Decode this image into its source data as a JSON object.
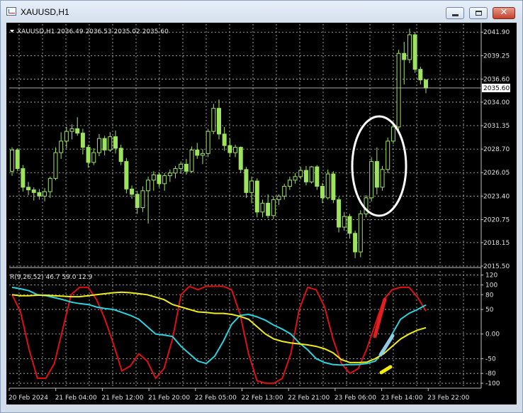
{
  "window": {
    "title": "XAUUSD,H1",
    "close_glyph": "✕"
  },
  "chart_data": [
    {
      "type": "candlestick",
      "symbol": "XAUUSD,H1",
      "header": "XAUUSD,H1  2036.49 2036.53 2035.02 2035.60",
      "current_price": "2035.60",
      "ylim": [
        2015.5,
        2042.8
      ],
      "y_ticks": [
        "2041.90",
        "2039.25",
        "2036.60",
        "2034.00",
        "2031.35",
        "2028.70",
        "2026.05",
        "2023.40",
        "2020.75",
        "2018.15",
        "2015.50"
      ],
      "x_ticks": [
        "20 Feb 2024",
        "21 Feb 04:00",
        "21 Feb 12:00",
        "21 Feb 20:00",
        "22 Feb 05:00",
        "22 Feb 13:00",
        "22 Feb 21:00",
        "23 Feb 06:00",
        "23 Feb 14:00",
        "23 Feb 22:00"
      ],
      "grid": true,
      "colors": {
        "background": "#000000",
        "bull": "#9de35d",
        "bear": "#9de35d",
        "grid": "#c0c0c0",
        "axis": "#c0c0c0"
      },
      "candles": [
        {
          "o": 2026.2,
          "h": 2028.9,
          "l": 2025.7,
          "c": 2028.6
        },
        {
          "o": 2028.6,
          "h": 2028.8,
          "l": 2026.2,
          "c": 2026.5
        },
        {
          "o": 2026.5,
          "h": 2026.9,
          "l": 2023.9,
          "c": 2024.4
        },
        {
          "o": 2024.4,
          "h": 2025.0,
          "l": 2023.5,
          "c": 2024.1
        },
        {
          "o": 2024.1,
          "h": 2024.4,
          "l": 2022.9,
          "c": 2023.8
        },
        {
          "o": 2023.8,
          "h": 2024.2,
          "l": 2023.0,
          "c": 2023.4
        },
        {
          "o": 2023.4,
          "h": 2024.3,
          "l": 2022.8,
          "c": 2023.9
        },
        {
          "o": 2023.9,
          "h": 2025.6,
          "l": 2023.2,
          "c": 2025.4
        },
        {
          "o": 2025.4,
          "h": 2028.9,
          "l": 2025.2,
          "c": 2028.3
        },
        {
          "o": 2028.3,
          "h": 2030.6,
          "l": 2027.6,
          "c": 2029.6
        },
        {
          "o": 2029.6,
          "h": 2031.2,
          "l": 2028.8,
          "c": 2030.7
        },
        {
          "o": 2030.7,
          "h": 2031.5,
          "l": 2029.8,
          "c": 2031.0
        },
        {
          "o": 2031.0,
          "h": 2032.3,
          "l": 2030.2,
          "c": 2030.5
        },
        {
          "o": 2030.5,
          "h": 2031.0,
          "l": 2028.1,
          "c": 2028.9
        },
        {
          "o": 2028.9,
          "h": 2029.2,
          "l": 2026.6,
          "c": 2027.2
        },
        {
          "o": 2027.2,
          "h": 2028.8,
          "l": 2026.9,
          "c": 2028.3
        },
        {
          "o": 2028.3,
          "h": 2030.4,
          "l": 2027.9,
          "c": 2029.9
        },
        {
          "o": 2029.9,
          "h": 2030.2,
          "l": 2028.0,
          "c": 2028.6
        },
        {
          "o": 2028.6,
          "h": 2030.6,
          "l": 2028.4,
          "c": 2030.1
        },
        {
          "o": 2030.1,
          "h": 2030.8,
          "l": 2028.2,
          "c": 2028.8
        },
        {
          "o": 2028.8,
          "h": 2029.2,
          "l": 2026.9,
          "c": 2027.3
        },
        {
          "o": 2027.3,
          "h": 2027.7,
          "l": 2023.7,
          "c": 2024.2
        },
        {
          "o": 2024.2,
          "h": 2024.6,
          "l": 2023.1,
          "c": 2023.6
        },
        {
          "o": 2023.6,
          "h": 2024.0,
          "l": 2021.4,
          "c": 2022.1
        },
        {
          "o": 2022.1,
          "h": 2024.5,
          "l": 2021.6,
          "c": 2024.0
        },
        {
          "o": 2024.0,
          "h": 2025.6,
          "l": 2020.3,
          "c": 2025.2
        },
        {
          "o": 2025.2,
          "h": 2026.2,
          "l": 2024.0,
          "c": 2025.8
        },
        {
          "o": 2025.8,
          "h": 2026.1,
          "l": 2024.4,
          "c": 2024.8
        },
        {
          "o": 2024.8,
          "h": 2026.0,
          "l": 2024.0,
          "c": 2025.7
        },
        {
          "o": 2025.7,
          "h": 2026.4,
          "l": 2025.0,
          "c": 2026.0
        },
        {
          "o": 2026.0,
          "h": 2026.8,
          "l": 2025.4,
          "c": 2026.5
        },
        {
          "o": 2026.5,
          "h": 2027.3,
          "l": 2025.9,
          "c": 2027.0
        },
        {
          "o": 2027.0,
          "h": 2027.6,
          "l": 2025.8,
          "c": 2026.2
        },
        {
          "o": 2026.2,
          "h": 2029.0,
          "l": 2026.0,
          "c": 2028.6
        },
        {
          "o": 2028.6,
          "h": 2029.4,
          "l": 2027.6,
          "c": 2028.0
        },
        {
          "o": 2028.0,
          "h": 2028.7,
          "l": 2027.0,
          "c": 2028.2
        },
        {
          "o": 2028.2,
          "h": 2031.0,
          "l": 2027.8,
          "c": 2030.7
        },
        {
          "o": 2030.7,
          "h": 2033.8,
          "l": 2030.4,
          "c": 2033.3
        },
        {
          "o": 2033.3,
          "h": 2034.3,
          "l": 2029.8,
          "c": 2030.4
        },
        {
          "o": 2030.4,
          "h": 2031.2,
          "l": 2028.5,
          "c": 2029.1
        },
        {
          "o": 2029.1,
          "h": 2029.9,
          "l": 2027.8,
          "c": 2028.3
        },
        {
          "o": 2028.3,
          "h": 2029.2,
          "l": 2027.8,
          "c": 2028.9
        },
        {
          "o": 2028.9,
          "h": 2029.0,
          "l": 2026.0,
          "c": 2026.4
        },
        {
          "o": 2026.4,
          "h": 2026.7,
          "l": 2023.2,
          "c": 2023.8
        },
        {
          "o": 2023.8,
          "h": 2025.6,
          "l": 2022.6,
          "c": 2025.1
        },
        {
          "o": 2025.1,
          "h": 2025.4,
          "l": 2021.0,
          "c": 2021.6
        },
        {
          "o": 2021.6,
          "h": 2023.0,
          "l": 2021.0,
          "c": 2022.6
        },
        {
          "o": 2022.6,
          "h": 2023.6,
          "l": 2020.9,
          "c": 2021.2
        },
        {
          "o": 2021.2,
          "h": 2023.4,
          "l": 2020.8,
          "c": 2023.0
        },
        {
          "o": 2023.0,
          "h": 2023.6,
          "l": 2022.4,
          "c": 2023.4
        },
        {
          "o": 2023.4,
          "h": 2024.8,
          "l": 2023.0,
          "c": 2024.5
        },
        {
          "o": 2024.5,
          "h": 2025.6,
          "l": 2024.1,
          "c": 2025.2
        },
        {
          "o": 2025.2,
          "h": 2026.0,
          "l": 2024.8,
          "c": 2025.6
        },
        {
          "o": 2025.6,
          "h": 2026.7,
          "l": 2025.3,
          "c": 2026.3
        },
        {
          "o": 2026.3,
          "h": 2026.8,
          "l": 2024.6,
          "c": 2025.0
        },
        {
          "o": 2025.0,
          "h": 2026.8,
          "l": 2024.8,
          "c": 2026.7
        },
        {
          "o": 2026.7,
          "h": 2026.9,
          "l": 2024.1,
          "c": 2024.5
        },
        {
          "o": 2024.5,
          "h": 2024.9,
          "l": 2022.6,
          "c": 2023.2
        },
        {
          "o": 2023.2,
          "h": 2026.4,
          "l": 2023.0,
          "c": 2025.9
        },
        {
          "o": 2025.9,
          "h": 2026.2,
          "l": 2022.6,
          "c": 2023.0
        },
        {
          "o": 2023.0,
          "h": 2023.3,
          "l": 2019.3,
          "c": 2019.9
        },
        {
          "o": 2019.9,
          "h": 2021.6,
          "l": 2019.5,
          "c": 2021.1
        },
        {
          "o": 2021.1,
          "h": 2021.4,
          "l": 2018.6,
          "c": 2019.2
        },
        {
          "o": 2019.2,
          "h": 2019.5,
          "l": 2016.4,
          "c": 2017.1
        },
        {
          "o": 2017.1,
          "h": 2021.8,
          "l": 2016.5,
          "c": 2021.4
        },
        {
          "o": 2021.4,
          "h": 2023.5,
          "l": 2021.0,
          "c": 2023.2
        },
        {
          "o": 2023.2,
          "h": 2027.8,
          "l": 2022.8,
          "c": 2027.3
        },
        {
          "o": 2027.3,
          "h": 2028.9,
          "l": 2023.6,
          "c": 2024.4
        },
        {
          "o": 2024.4,
          "h": 2026.8,
          "l": 2024.0,
          "c": 2026.4
        },
        {
          "o": 2026.4,
          "h": 2030.0,
          "l": 2026.0,
          "c": 2029.6
        },
        {
          "o": 2029.6,
          "h": 2031.8,
          "l": 2029.3,
          "c": 2031.2
        },
        {
          "o": 2031.2,
          "h": 2039.9,
          "l": 2030.9,
          "c": 2039.5
        },
        {
          "o": 2039.5,
          "h": 2040.8,
          "l": 2036.0,
          "c": 2038.8
        },
        {
          "o": 2038.8,
          "h": 2042.3,
          "l": 2038.4,
          "c": 2041.6
        },
        {
          "o": 2041.6,
          "h": 2041.9,
          "l": 2037.3,
          "c": 2037.7
        },
        {
          "o": 2037.7,
          "h": 2038.0,
          "l": 2036.0,
          "c": 2036.5
        },
        {
          "o": 2036.5,
          "h": 2036.6,
          "l": 2035.0,
          "c": 2035.6
        }
      ]
    },
    {
      "type": "line",
      "header": "R(9,26,52) 46.7 59.0 12.9",
      "ylim": [
        -110,
        128
      ],
      "y_ticks": [
        120,
        100,
        80,
        50,
        0,
        -50,
        -80,
        -100
      ],
      "y_tick_labels": [
        "120",
        "100",
        "80",
        "50",
        "0.00",
        "-50",
        "-80",
        "-100"
      ],
      "series": [
        {
          "color": "#e01010",
          "values": [
            80,
            45,
            -30,
            -90,
            -90,
            -60,
            10,
            80,
            95,
            95,
            70,
            30,
            -20,
            -75,
            -65,
            -40,
            -55,
            -90,
            -70,
            -10,
            80,
            97,
            90,
            97,
            97,
            97,
            90,
            40,
            -40,
            -95,
            -100,
            -100,
            -90,
            -40,
            50,
            95,
            90,
            55,
            -10,
            -60,
            -80,
            -70,
            -30,
            20,
            70,
            90,
            95,
            95,
            75,
            46.7
          ]
        },
        {
          "color": "#27d4e0",
          "values": [
            95,
            92,
            88,
            80,
            78,
            74,
            70,
            65,
            62,
            60,
            55,
            52,
            50,
            44,
            38,
            30,
            15,
            0,
            -2,
            -5,
            -25,
            -40,
            -55,
            -60,
            -45,
            -15,
            20,
            38,
            40,
            35,
            28,
            18,
            10,
            0,
            -18,
            -32,
            -50,
            -58,
            -62,
            -63,
            -62,
            -62,
            -60,
            -55,
            -35,
            0,
            30,
            42,
            50,
            59.0
          ]
        },
        {
          "color": "#f0ec18",
          "values": [
            80,
            78,
            78,
            79,
            79,
            78,
            77,
            76,
            76,
            78,
            80,
            82,
            84,
            85,
            84,
            82,
            80,
            75,
            70,
            60,
            55,
            50,
            45,
            44,
            42,
            42,
            40,
            36,
            30,
            15,
            0,
            -10,
            -15,
            -18,
            -20,
            -22,
            -25,
            -30,
            -38,
            -52,
            -58,
            -58,
            -57,
            -50,
            -40,
            -25,
            -10,
            0,
            8,
            12.9
          ]
        }
      ]
    }
  ]
}
